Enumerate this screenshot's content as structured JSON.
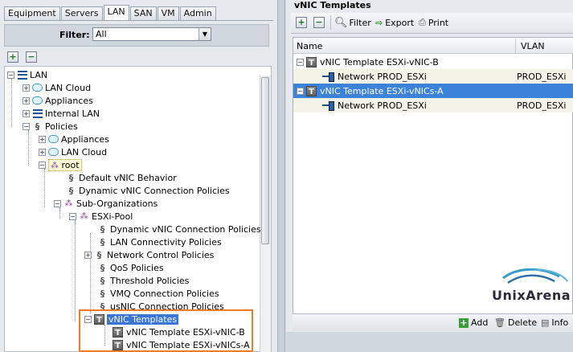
{
  "left_panel": {
    "tabs": [
      "Equipment",
      "Servers",
      "LAN",
      "SAN",
      "VM",
      "Admin"
    ],
    "active_tab": "LAN",
    "filter": {
      "label": "Filter:",
      "value": "All"
    },
    "tree": {
      "root": "LAN",
      "lan_cloud": "LAN Cloud",
      "appliances": "Appliances",
      "internal_lan": "Internal LAN",
      "policies": "Policies",
      "pol_appliances": "Appliances",
      "pol_lan_cloud": "LAN Cloud",
      "root_org": "root",
      "default_vnic_behavior": "Default vNIC Behavior",
      "dynamic_vnic_policies": "Dynamic vNIC Connection Policies",
      "sub_orgs": "Sub-Organizations",
      "esxi_pool": "ESXi-Pool",
      "pool_dynamic_vnic": "Dynamic vNIC Connection Policies",
      "lan_connectivity": "LAN Connectivity Policies",
      "network_control": "Network Control Policies",
      "qos": "QoS Policies",
      "threshold": "Threshold Policies",
      "vmq": "VMQ Connection Policies",
      "usnic": "usNIC Connection Policies",
      "vnic_templates": "vNIC Templates",
      "tmpl_b": "vNIC Template ESXi-vNIC-B",
      "tmpl_a": "vNIC Template ESXi-vNICs-A"
    }
  },
  "right_panel": {
    "title": "vNIC Templates",
    "toolbar": {
      "filter": "Filter",
      "export": "Export",
      "print": "Print"
    },
    "columns": {
      "name": "Name",
      "vlan": "VLAN"
    },
    "rows": [
      {
        "name": "vNIC Template ESXi-vNIC-B",
        "vlan": ""
      },
      {
        "name": "Network PROD_ESXi",
        "vlan": "PROD_ESXi"
      },
      {
        "name": "vNIC Template ESXi-vNICs-A",
        "vlan": ""
      },
      {
        "name": "Network PROD_ESXi",
        "vlan": "PROD_ESXi"
      }
    ],
    "logo_text": "UnixArena",
    "bottom_buttons": {
      "add": "Add",
      "delete": "Delete",
      "info": "Info"
    }
  },
  "colors": {
    "selection": "#3875d7",
    "highlight_box": "#f07c26"
  }
}
